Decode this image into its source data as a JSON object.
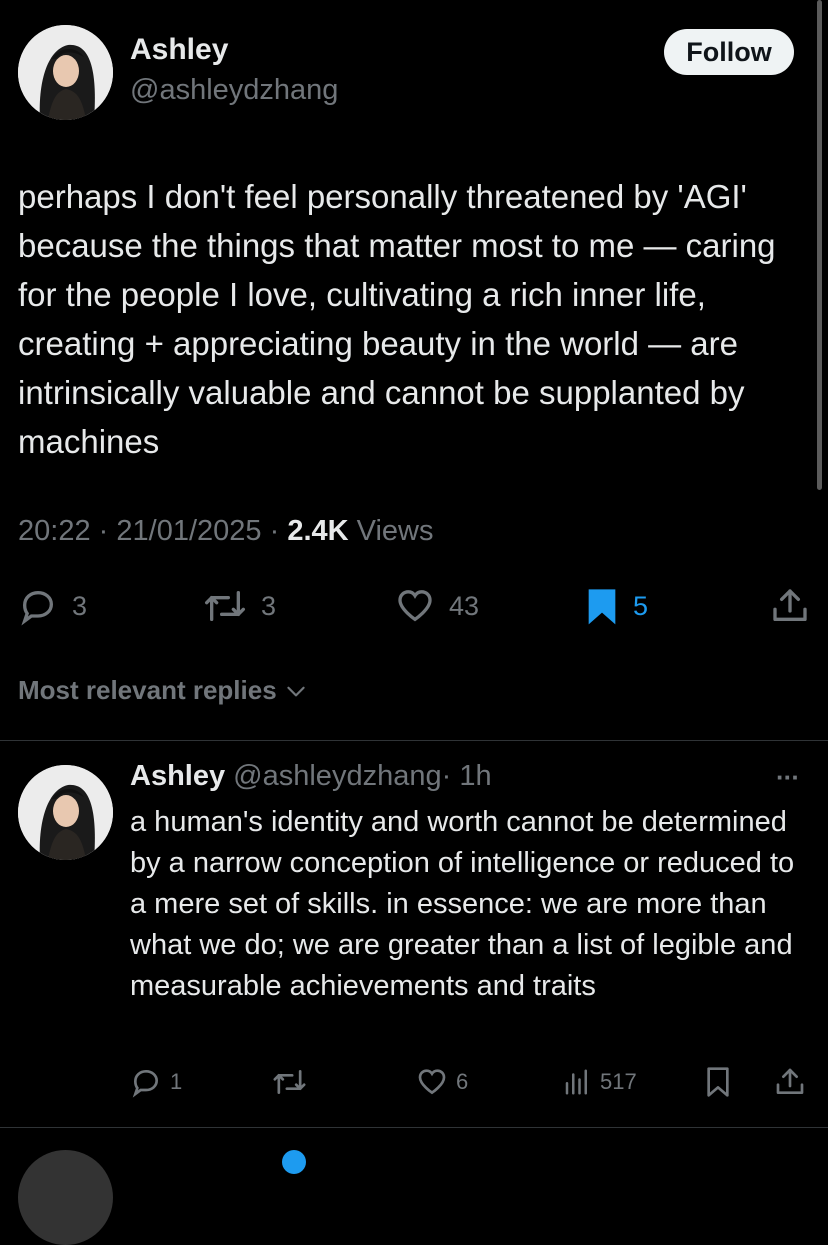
{
  "tweet": {
    "author_name": "Ashley",
    "author_handle": "@ashleydzhang",
    "follow_label": "Follow",
    "text": "perhaps I don't feel personally threatened by 'AGI' because the things that matter most to me — caring for the people I love, cultivating a rich inner life, creating + appreciating beauty in the world — are intrinsically valuable and cannot be supplanted by machines",
    "time": "20:22",
    "date": "21/01/2025",
    "views_count": "2.4K",
    "views_label": "Views",
    "separator": "·",
    "actions": {
      "replies": "3",
      "reposts": "3",
      "likes": "43",
      "bookmarks": "5"
    },
    "bookmark_color": "#1d9bf0"
  },
  "replies_sort": {
    "label": "Most relevant replies"
  },
  "reply": {
    "author_name": "Ashley",
    "author_handle": "@ashleydzhang",
    "separator": "·",
    "age": "1h",
    "more_label": "···",
    "text": "a human's identity and worth cannot be determined by a narrow conception of intelligence or reduced to a mere set of skills. in essence: we are more than what we do; we are greater than a list of legible and measurable achievements and traits",
    "actions": {
      "replies": "1",
      "likes": "6",
      "views": "517"
    }
  }
}
